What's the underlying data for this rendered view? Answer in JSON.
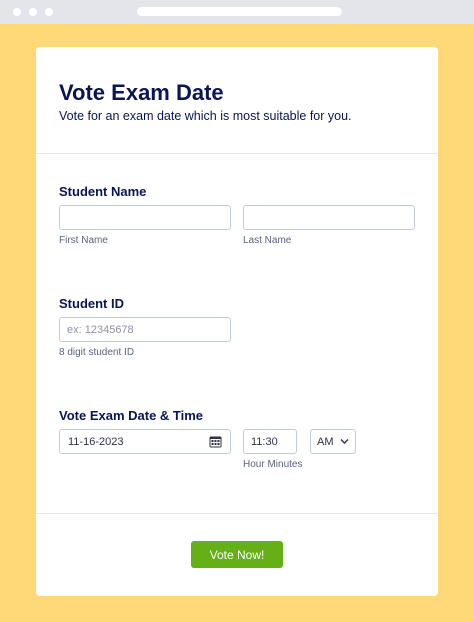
{
  "form": {
    "title": "Vote Exam Date",
    "subtitle": "Vote for an exam date which is most suitable for you.",
    "student_name": {
      "label": "Student Name",
      "first_name": {
        "value": "",
        "sublabel": "First Name"
      },
      "last_name": {
        "value": "",
        "sublabel": "Last Name"
      }
    },
    "student_id": {
      "label": "Student ID",
      "placeholder": "ex: 12345678",
      "sublabel": "8 digit student ID"
    },
    "exam_date": {
      "label": "Vote Exam Date & Time",
      "date_value": "11-16-2023",
      "time_value": "11:30",
      "ampm_value": "AM",
      "time_sublabel": "Hour Minutes",
      "calendar_icon": "calendar-icon",
      "dropdown_icon": "chevron-down-icon"
    },
    "submit_label": "Vote Now!"
  },
  "colors": {
    "background": "#ffd978",
    "heading": "#0a1551",
    "submit": "#64b016",
    "border": "#c3cad8"
  }
}
